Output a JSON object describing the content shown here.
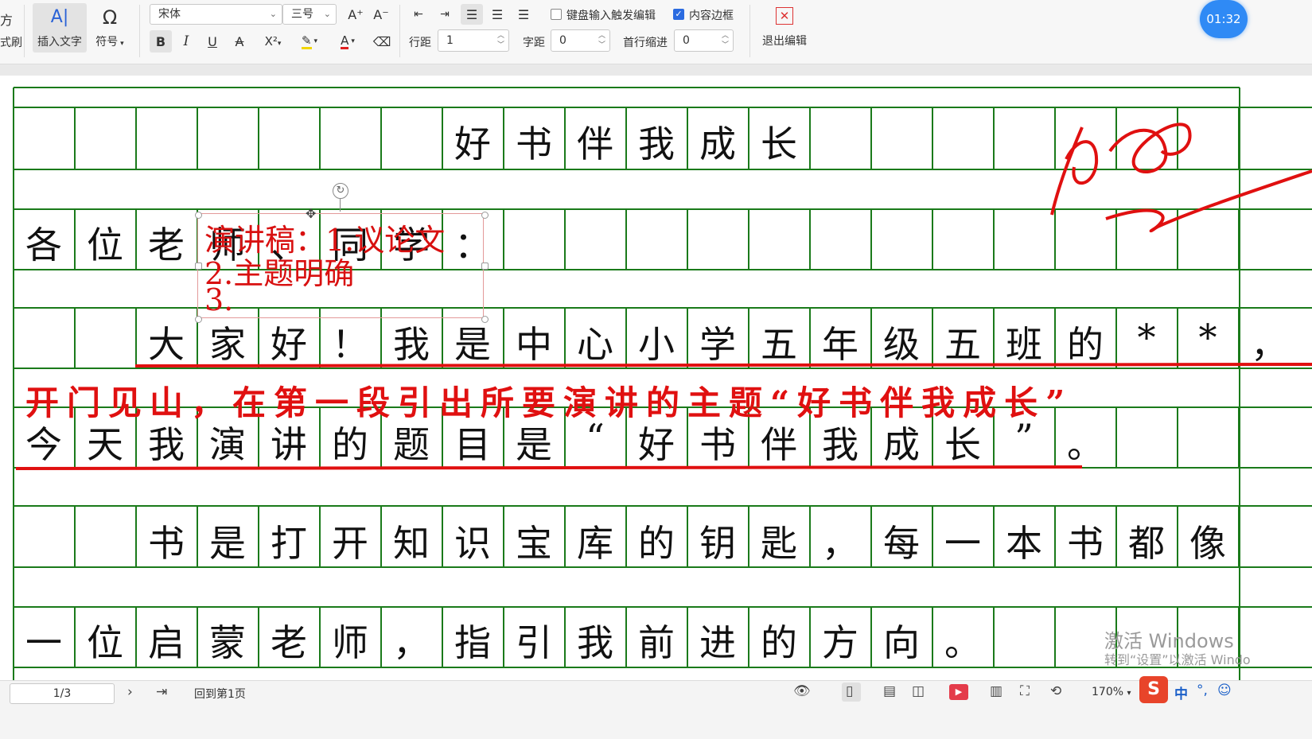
{
  "toolbar": {
    "partial_left_1": "方",
    "partial_left_2": "式刷",
    "insert_text_label": "插入文字",
    "symbol_label": "符号",
    "font_name": "宋体",
    "font_size": "三号",
    "line_spacing_label": "行距",
    "line_spacing_value": "1",
    "char_spacing_label": "字距",
    "char_spacing_value": "0",
    "indent_label": "首行缩进",
    "indent_value": "0",
    "keyboard_trigger_label": "键盘输入触发编辑",
    "content_border_label": "内容边框",
    "exit_edit_label": "退出编辑",
    "keyboard_trigger_checked": false,
    "content_border_checked": true
  },
  "timer": "01:32",
  "document": {
    "title_chars": [
      "好",
      "书",
      "伴",
      "我",
      "成",
      "长"
    ],
    "row2": [
      "各",
      "位",
      "老",
      "师",
      "、",
      "同",
      "学",
      "："
    ],
    "row3": [
      "大",
      "家",
      "好",
      "！",
      "我",
      "是",
      "中",
      "心",
      "小",
      "学",
      "五",
      "年",
      "级",
      "五",
      "班",
      "的",
      "*",
      "*",
      "，"
    ],
    "row4": [
      "今",
      "天",
      "我",
      "演",
      "讲",
      "的",
      "题",
      "目",
      "是",
      "“",
      "好",
      "书",
      "伴",
      "我",
      "成",
      "长",
      "”",
      "。"
    ],
    "row5": [
      "书",
      "是",
      "打",
      "开",
      "知",
      "识",
      "宝",
      "库",
      "的",
      "钥",
      "匙",
      "，",
      "每",
      "一",
      "本",
      "书",
      "都",
      "像"
    ],
    "row6": [
      "一",
      "位",
      "启",
      "蒙",
      "老",
      "师",
      "，",
      "指",
      "引",
      "我",
      "前",
      "进",
      "的",
      "方",
      "向",
      "。"
    ],
    "annotation": "开门见山，在第一段引出所要演讲的主题“好书伴我成长”",
    "textbox_lines": [
      "演讲稿：1.议论文",
      "2.主题明确",
      "3."
    ],
    "ink_color": "#e01010"
  },
  "statusbar": {
    "page_indicator": "1/3",
    "back_to_first": "回到第1页",
    "zoom": "170%",
    "ime_lang": "中"
  },
  "watermark": {
    "line1": "激活 Windows",
    "line2": "转到“设置”以激活 Windo"
  }
}
